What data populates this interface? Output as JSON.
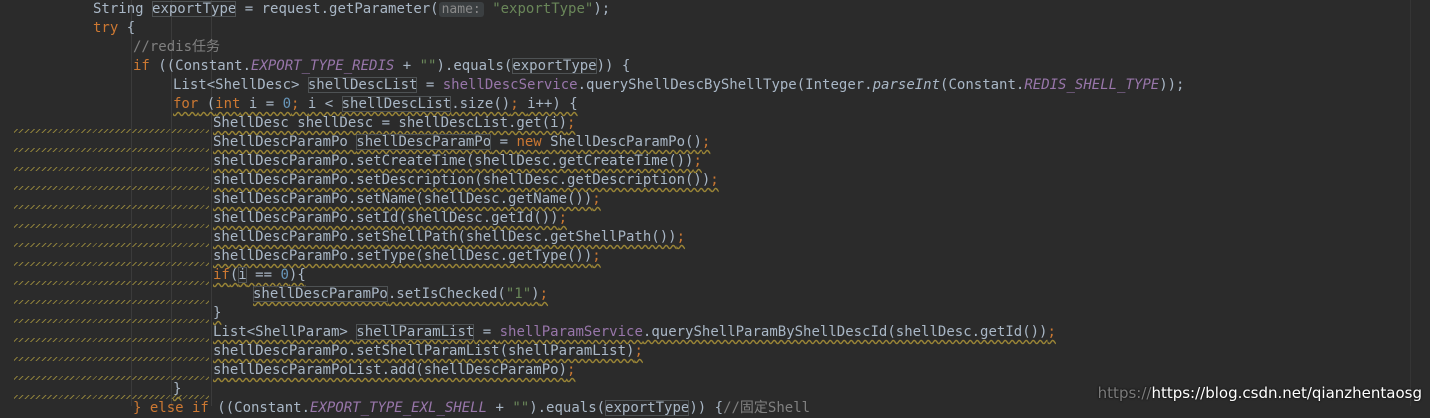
{
  "editor": {
    "lines": [
      {
        "id": "l1",
        "parts": [
          {
            "t": "String ",
            "c": ""
          },
          {
            "t": "exportType",
            "c": "box"
          },
          {
            "t": " = request.getParameter(",
            "c": ""
          },
          {
            "t": "name:",
            "c": "hint"
          },
          {
            "t": " ",
            "c": ""
          },
          {
            "t": "\"exportType\"",
            "c": "str"
          },
          {
            "t": ");",
            "c": ""
          }
        ]
      },
      {
        "id": "l2",
        "parts": [
          {
            "t": "try",
            "c": "kw"
          },
          {
            "t": " {",
            "c": ""
          }
        ]
      },
      {
        "id": "l3",
        "parts": [
          {
            "t": "//redis任务",
            "c": "cmt"
          }
        ]
      },
      {
        "id": "l4",
        "parts": [
          {
            "t": "if",
            "c": "kw"
          },
          {
            "t": " ((Constant.",
            "c": ""
          },
          {
            "t": "EXPORT_TYPE_REDIS",
            "c": "fld"
          },
          {
            "t": " + ",
            "c": ""
          },
          {
            "t": "\"\"",
            "c": "str"
          },
          {
            "t": ").equals(",
            "c": ""
          },
          {
            "t": "exportType",
            "c": "box"
          },
          {
            "t": ")) {",
            "c": ""
          }
        ]
      },
      {
        "id": "l5",
        "parts": [
          {
            "t": "List<ShellDesc> ",
            "c": ""
          },
          {
            "t": "shellDescList",
            "c": "box"
          },
          {
            "t": " = ",
            "c": ""
          },
          {
            "t": "shellDescService",
            "c": "svc"
          },
          {
            "t": ".queryShellDescByShellType(Integer.",
            "c": ""
          },
          {
            "t": "parseInt",
            "c": "ital"
          },
          {
            "t": "(Constant.",
            "c": ""
          },
          {
            "t": "REDIS_SHELL_TYPE",
            "c": "fld"
          },
          {
            "t": "));",
            "c": ""
          }
        ]
      },
      {
        "id": "l6",
        "parts": [
          {
            "t": "for",
            "c": "kw warn"
          },
          {
            "t": " (",
            "c": "warn"
          },
          {
            "t": "int",
            "c": "kw warn"
          },
          {
            "t": " i = ",
            "c": "warn"
          },
          {
            "t": "0",
            "c": "num warn"
          },
          {
            "t": "; ",
            "c": "kw warn"
          },
          {
            "t": "i < ",
            "c": "warn"
          },
          {
            "t": "shellDescList",
            "c": "box warn"
          },
          {
            "t": ".size()",
            "c": "warn"
          },
          {
            "t": "; ",
            "c": "kw warn"
          },
          {
            "t": "i++) {",
            "c": "warn"
          }
        ]
      },
      {
        "id": "l7",
        "parts": [
          {
            "t": "ShellDesc shellDesc = shellDescList.get(i)",
            "c": "warn"
          },
          {
            "t": ";",
            "c": "kw warn"
          }
        ]
      },
      {
        "id": "l8",
        "parts": [
          {
            "t": "ShellDescParamPo ",
            "c": "warn"
          },
          {
            "t": "shellDescParamPo",
            "c": "box warn"
          },
          {
            "t": " = ",
            "c": "warn"
          },
          {
            "t": "new",
            "c": "kw warn"
          },
          {
            "t": " ShellDescParamPo()",
            "c": "warn"
          },
          {
            "t": ";",
            "c": "kw warn"
          }
        ]
      },
      {
        "id": "l9",
        "parts": [
          {
            "t": "shellDescParamPo.setCreateTime(shellDesc.getCreateTime())",
            "c": "warn"
          },
          {
            "t": ";",
            "c": "kw warn"
          }
        ]
      },
      {
        "id": "l10",
        "parts": [
          {
            "t": "shellDescParamPo.setDescription(shellDesc.getDescription())",
            "c": "warn"
          },
          {
            "t": ";",
            "c": "kw warn"
          }
        ]
      },
      {
        "id": "l11",
        "parts": [
          {
            "t": "shellDescParamPo.setName(shellDesc.getName())",
            "c": "warn"
          },
          {
            "t": ";",
            "c": "kw warn"
          }
        ]
      },
      {
        "id": "l12",
        "parts": [
          {
            "t": "shellDescParamPo.setId(shellDesc.getId())",
            "c": "warn"
          },
          {
            "t": ";",
            "c": "kw warn"
          }
        ]
      },
      {
        "id": "l13",
        "parts": [
          {
            "t": "shellDescParamPo.setShellPath(shellDesc.getShellPath())",
            "c": "warn"
          },
          {
            "t": ";",
            "c": "kw warn"
          }
        ]
      },
      {
        "id": "l14",
        "parts": [
          {
            "t": "shellDescParamPo.setType(shellDesc.getType())",
            "c": "warn"
          },
          {
            "t": ";",
            "c": "kw warn"
          }
        ]
      },
      {
        "id": "l15",
        "parts": [
          {
            "t": "if",
            "c": "kw warn"
          },
          {
            "t": "(",
            "c": "warn"
          },
          {
            "t": "i",
            "c": "box warn"
          },
          {
            "t": " == ",
            "c": "warn"
          },
          {
            "t": "0",
            "c": "num warn"
          },
          {
            "t": "){",
            "c": "warn"
          }
        ]
      },
      {
        "id": "l16",
        "parts": [
          {
            "t": "shellDescParamPo",
            "c": "box warn"
          },
          {
            "t": ".setIsChecked(",
            "c": "warn"
          },
          {
            "t": "\"1\"",
            "c": "str warn"
          },
          {
            "t": ")",
            "c": "warn"
          },
          {
            "t": ";",
            "c": "kw warn"
          }
        ]
      },
      {
        "id": "l17",
        "parts": [
          {
            "t": "}",
            "c": "warn"
          }
        ]
      },
      {
        "id": "l18",
        "parts": [
          {
            "t": "List<ShellParam> ",
            "c": "warn"
          },
          {
            "t": "shellParamList",
            "c": "box warn"
          },
          {
            "t": " = ",
            "c": "warn"
          },
          {
            "t": "shellParamService",
            "c": "svc warn"
          },
          {
            "t": ".queryShellParamByShellDescId(shellDesc.getId())",
            "c": "warn"
          },
          {
            "t": ";",
            "c": "kw warn"
          }
        ]
      },
      {
        "id": "l19",
        "parts": [
          {
            "t": "shellDescParamPo.setShellParamList(shellParamList)",
            "c": "warn"
          },
          {
            "t": ";",
            "c": "kw warn"
          }
        ]
      },
      {
        "id": "l20",
        "parts": [
          {
            "t": "shellDescParamPoList.add(shellDescParamPo)",
            "c": "warn"
          },
          {
            "t": ";",
            "c": "kw warn"
          }
        ]
      },
      {
        "id": "l21",
        "parts": [
          {
            "t": "}",
            "c": "warn"
          }
        ]
      },
      {
        "id": "l22",
        "parts": [
          {
            "t": "} else if",
            "c": "kw"
          },
          {
            "t": " ((Constant.",
            "c": ""
          },
          {
            "t": "EXPORT_TYPE_EXL_SHELL",
            "c": "fld"
          },
          {
            "t": " + ",
            "c": ""
          },
          {
            "t": "\"\"",
            "c": "str"
          },
          {
            "t": ").equals(",
            "c": ""
          },
          {
            "t": "exportType",
            "c": "box"
          },
          {
            "t": ")) {",
            "c": ""
          },
          {
            "t": "//固定Shell",
            "c": "cmt"
          }
        ]
      }
    ]
  },
  "watermark": {
    "prefix": "https://",
    "text": "https://blog.csdn.net/qianzhentaosg"
  }
}
